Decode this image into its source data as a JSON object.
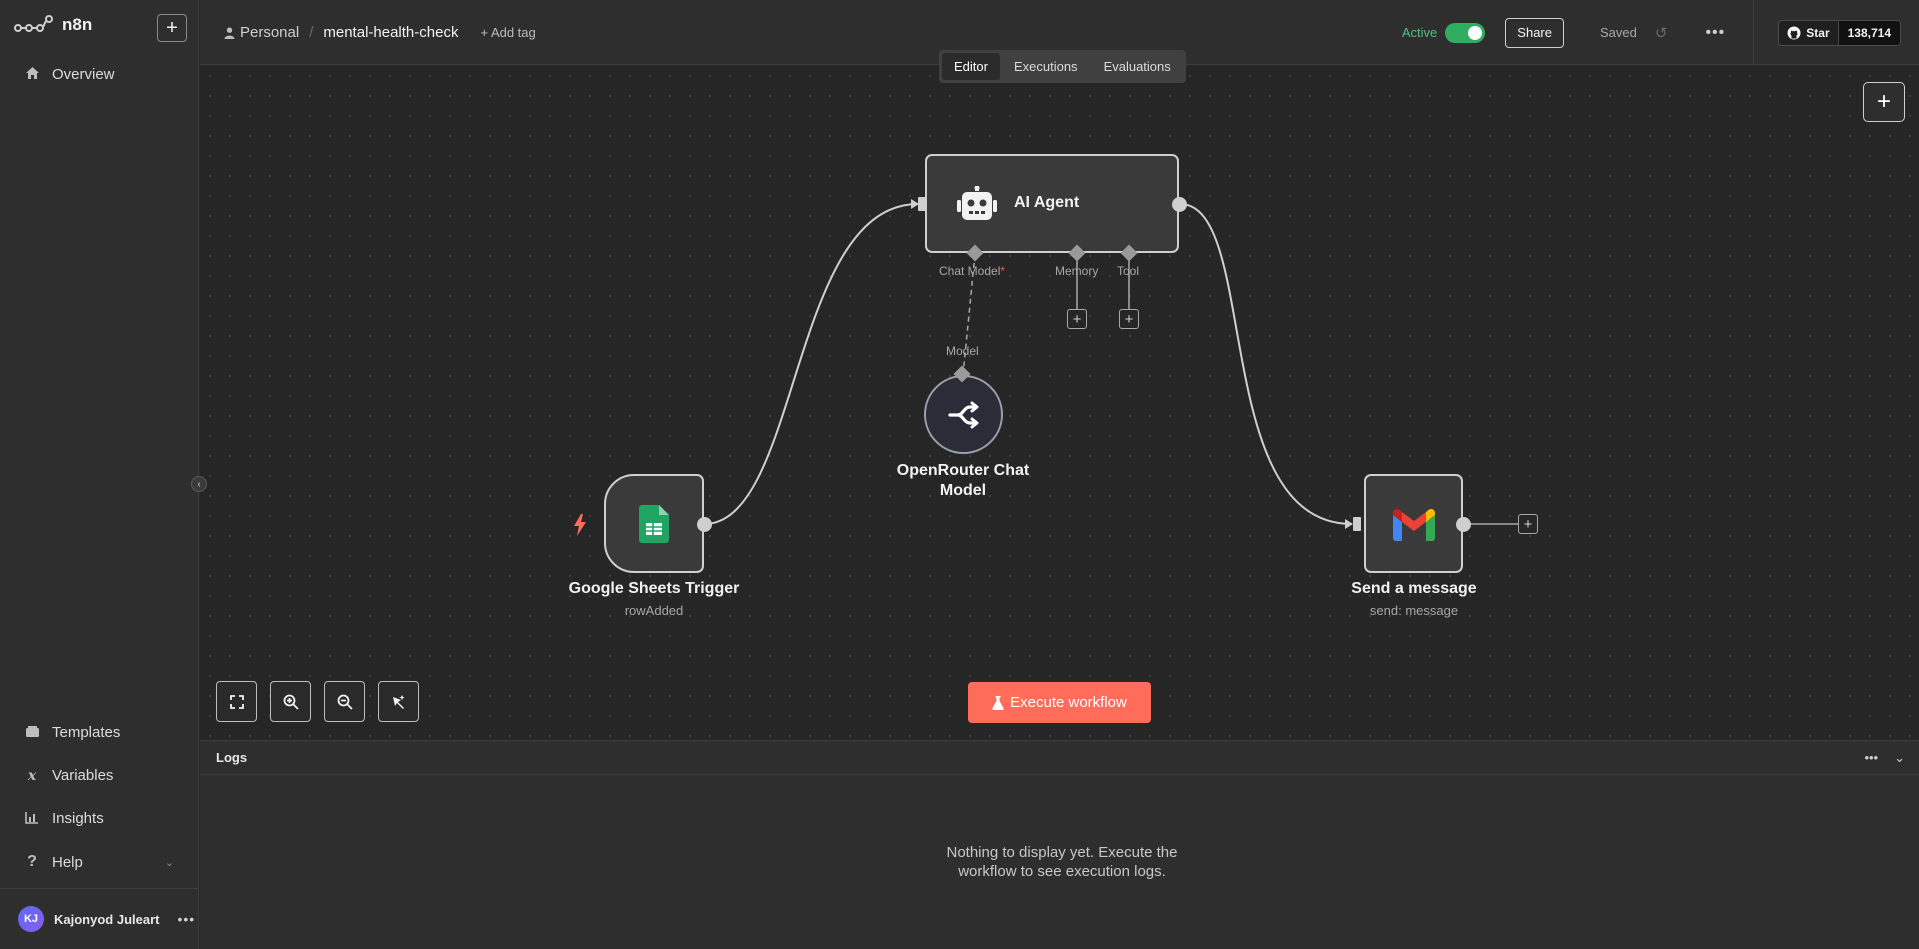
{
  "app": {
    "name": "n8n"
  },
  "sidebar": {
    "overview": "Overview",
    "bottom_items": [
      {
        "label": "Templates",
        "icon": "templates-icon"
      },
      {
        "label": "Variables",
        "icon": "variables-icon"
      },
      {
        "label": "Insights",
        "icon": "insights-icon"
      },
      {
        "label": "Help",
        "icon": "help-icon"
      }
    ],
    "user": {
      "initials": "KJ",
      "name": "Kajonyod Juleart"
    }
  },
  "header": {
    "project": "Personal",
    "workflow_name": "mental-health-check",
    "add_tag": "+ Add tag",
    "active_label": "Active",
    "share": "Share",
    "saved": "Saved",
    "github": {
      "star": "Star",
      "count": "138,714"
    }
  },
  "tabs": [
    "Editor",
    "Executions",
    "Evaluations"
  ],
  "nodes": {
    "agent": {
      "title": "AI Agent",
      "ports": {
        "chat_model": "Chat Model",
        "required": "*",
        "memory": "Memory",
        "tool": "Tool"
      }
    },
    "model": {
      "title": "OpenRouter Chat Model",
      "port": "Model"
    },
    "trigger": {
      "title": "Google Sheets Trigger",
      "subtitle": "rowAdded"
    },
    "gmail": {
      "title": "Send a message",
      "subtitle": "send: message"
    }
  },
  "toolbar": {
    "execute": "Execute workflow"
  },
  "logs": {
    "title": "Logs",
    "empty": "Nothing to display yet. Execute the workflow to see execution logs."
  },
  "colors": {
    "accent": "#ff6d5a",
    "active": "#2fae62",
    "sheets": "#1fa463"
  }
}
